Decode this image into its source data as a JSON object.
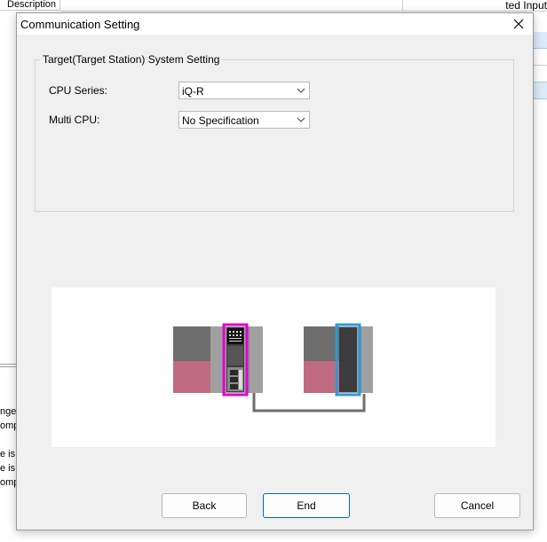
{
  "background": {
    "header_description": "Description",
    "header_right_fragment": "ted Input",
    "left_text_lines": [
      "nge",
      "omp",
      "",
      "e is",
      "e is",
      "omp"
    ]
  },
  "dialog": {
    "title": "Communication Setting",
    "group_title": "Target(Target Station) System Setting",
    "fields": {
      "cpu_series": {
        "label": "CPU Series:",
        "value": "iQ-R"
      },
      "multi_cpu": {
        "label": "Multi CPU:",
        "value": "No Specification"
      }
    },
    "buttons": {
      "back": "Back",
      "end": "End",
      "cancel": "Cancel"
    }
  },
  "colors": {
    "dialog_bg": "#f0f0f0",
    "cpu_highlight": "#e000d0",
    "target_highlight": "#2e9ad8",
    "module_pink": "#c06a80",
    "module_gray_dark": "#6e6e6e",
    "module_gray": "#a0a0a0",
    "default_button_border": "#0067c0"
  },
  "icons": {
    "close": "close-icon",
    "dropdown": "chevron-down-icon"
  }
}
